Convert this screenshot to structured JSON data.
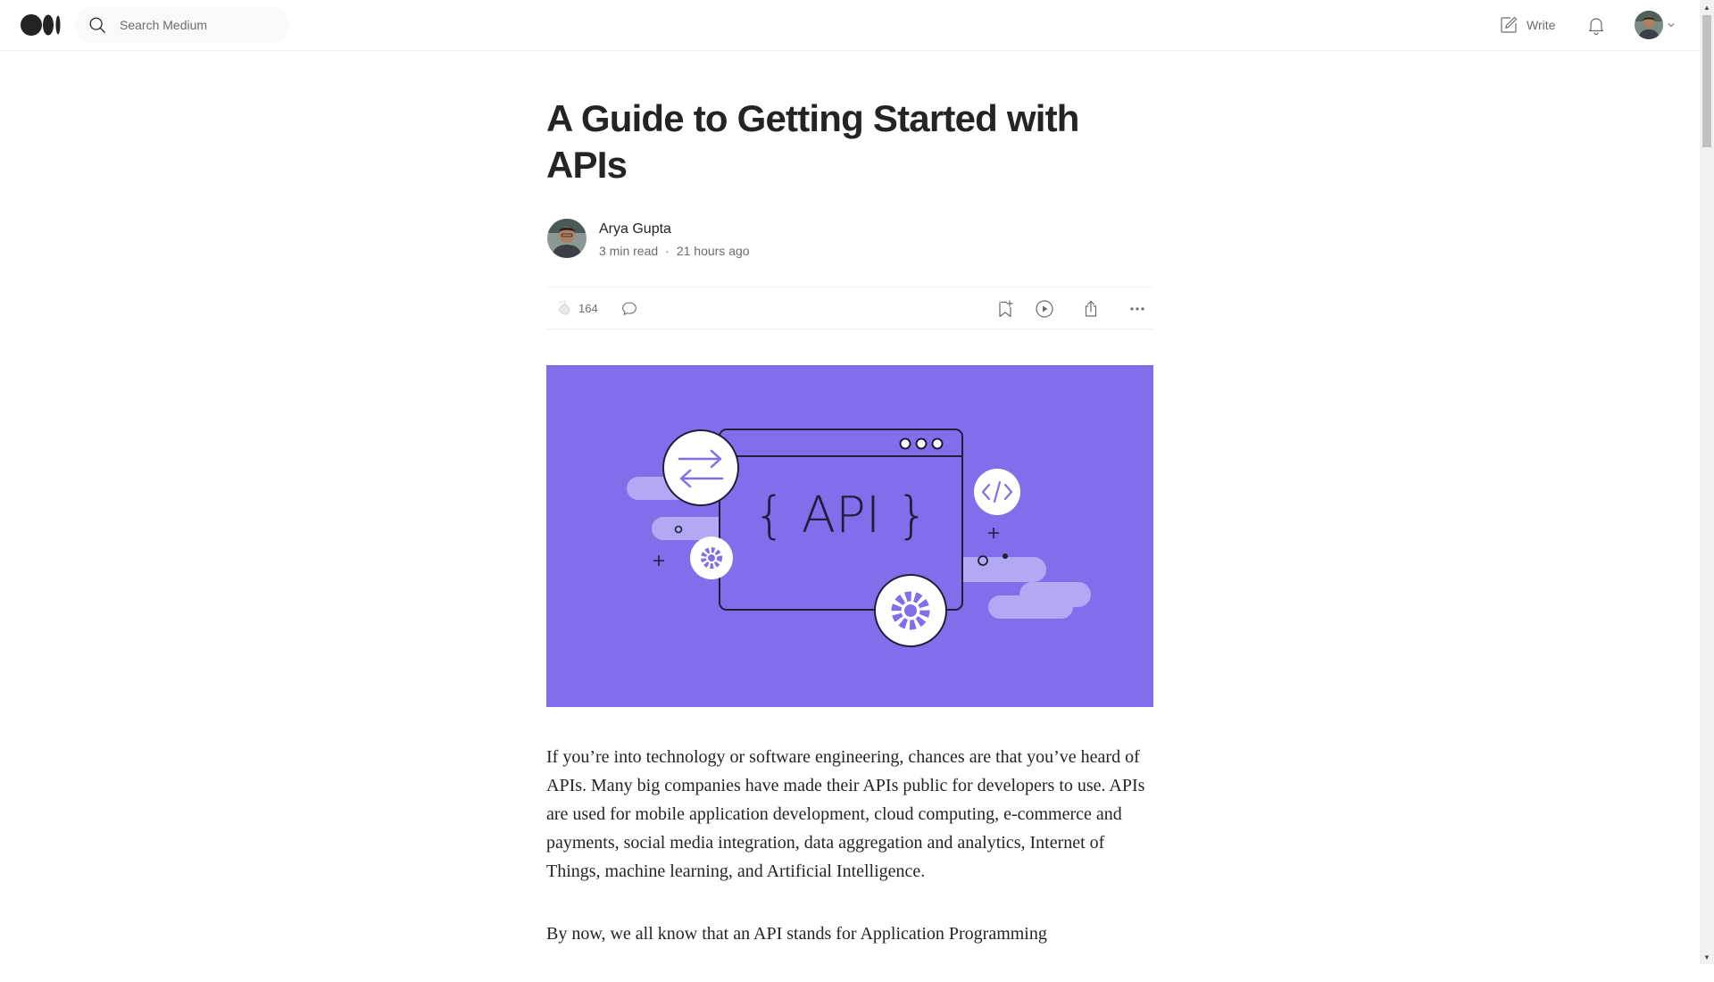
{
  "nav": {
    "search_placeholder": "Search Medium",
    "write_label": "Write"
  },
  "article": {
    "title": "A Guide to Getting Started with APIs",
    "author": "Arya Gupta",
    "read_time": "3 min read",
    "separator": "·",
    "published": "21 hours ago",
    "clap_count": "164",
    "hero_image": {
      "text": "{ API }",
      "background_color": "#826eea"
    },
    "paragraphs": [
      "If you’re into technology or software engineering, chances are that you’ve heard of APIs. Many big companies have made their APIs public for developers to use. APIs are used for mobile application development, cloud computing, e-commerce and payments, social media integration, data aggregation and analytics, Internet of Things, machine learning, and Artificial Intelligence.",
      "By now, we all know that an API stands for Application Programming"
    ]
  },
  "icons": {
    "logo": "medium-logo-icon",
    "search": "search-icon",
    "write": "write-icon",
    "notifications": "bell-icon",
    "clap": "clap-icon",
    "response": "speech-bubble-icon",
    "save": "bookmark-plus-icon",
    "listen": "play-icon",
    "share": "share-icon",
    "more": "more-dots-icon"
  }
}
